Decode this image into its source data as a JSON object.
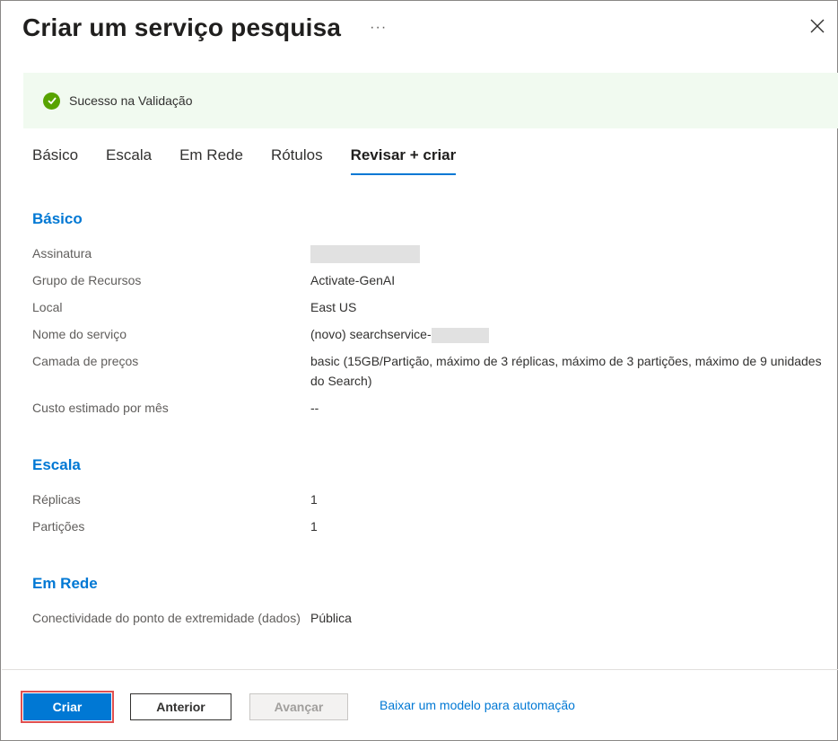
{
  "header": {
    "title": "Criar um serviço pesquisa",
    "more_label": "···"
  },
  "banner": {
    "status_text": "Sucesso na Validação",
    "status_color": "#57a300",
    "icon": "check-circle-icon"
  },
  "tabs": [
    {
      "label": "Básico",
      "active": false
    },
    {
      "label": "Escala",
      "active": false
    },
    {
      "label": "Em Rede",
      "active": false
    },
    {
      "label": "Rótulos",
      "active": false
    },
    {
      "label": "Revisar + criar",
      "active": true
    }
  ],
  "sections": {
    "basico": {
      "title": "Básico",
      "rows": [
        {
          "label": "Assinatura",
          "value": ""
        },
        {
          "label": "Grupo de Recursos",
          "value": "Activate-GenAI"
        },
        {
          "label": "Local",
          "value": "East US"
        },
        {
          "label": "Nome do serviço",
          "value": "(novo) searchservice-"
        },
        {
          "label": "Camada de preços",
          "value": "basic (15GB/Partição, máximo de 3 réplicas, máximo de 3 partições, máximo de 9 unidades do Search)"
        },
        {
          "label": "Custo estimado por mês",
          "value": "--"
        }
      ]
    },
    "escala": {
      "title": "Escala",
      "rows": [
        {
          "label": "Réplicas",
          "value": "1"
        },
        {
          "label": "Partições",
          "value": "1"
        }
      ]
    },
    "rede": {
      "title": "Em Rede",
      "rows": [
        {
          "label": "Conectividade do ponto de extremidade (dados)",
          "value": "Pública"
        }
      ]
    }
  },
  "footer": {
    "create_label": "Criar",
    "previous_label": "Anterior",
    "next_label": "Avançar",
    "download_link": "Baixar um modelo para automação"
  },
  "colors": {
    "accent": "#0078d4",
    "success_bg": "#f1faf0",
    "highlight": "#e05050"
  }
}
